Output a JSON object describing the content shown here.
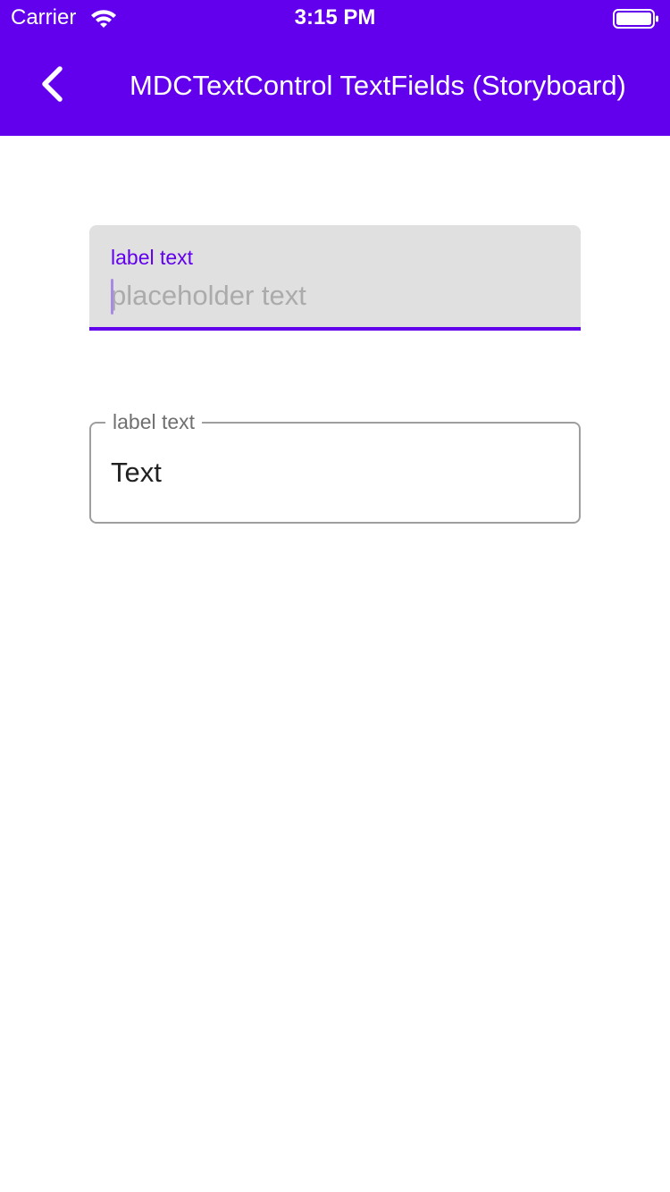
{
  "status_bar": {
    "carrier": "Carrier",
    "time": "3:15 PM",
    "wifi_icon": "wifi-icon",
    "battery_icon": "battery-full-icon"
  },
  "app_bar": {
    "title": "MDCTextControl TextFields (Storyboard)",
    "back_icon": "chevron-left-icon",
    "background_color": "#6200EE"
  },
  "filled_text_field": {
    "label": "label text",
    "value": "",
    "placeholder": "placeholder text",
    "state": "focused",
    "accent_color": "#6200EE",
    "container_color": "#E0E0E0"
  },
  "outlined_text_field": {
    "label": "label text",
    "value": "Text",
    "placeholder": "",
    "state": "normal",
    "outline_color": "#9E9E9E"
  }
}
